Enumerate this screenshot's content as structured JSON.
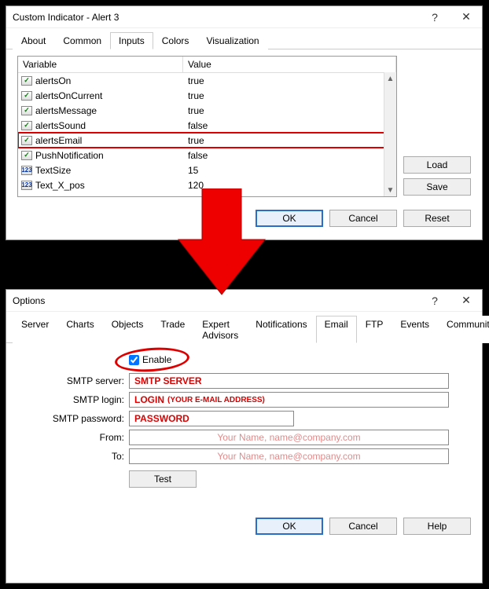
{
  "dialog1": {
    "title": "Custom Indicator - Alert 3",
    "help_icon": "?",
    "close_icon": "✕",
    "tabs": [
      "About",
      "Common",
      "Inputs",
      "Colors",
      "Visualization"
    ],
    "active_tab": 2,
    "columns": {
      "variable": "Variable",
      "value": "Value"
    },
    "rows": [
      {
        "icon": "bool",
        "name": "alertsOn",
        "value": "true"
      },
      {
        "icon": "bool",
        "name": "alertsOnCurrent",
        "value": "true"
      },
      {
        "icon": "bool",
        "name": "alertsMessage",
        "value": "true"
      },
      {
        "icon": "bool",
        "name": "alertsSound",
        "value": "false"
      },
      {
        "icon": "bool",
        "name": "alertsEmail",
        "value": "true",
        "highlight": true
      },
      {
        "icon": "bool",
        "name": "PushNotification",
        "value": "false"
      },
      {
        "icon": "num",
        "name": "TextSize",
        "value": "15"
      },
      {
        "icon": "num",
        "name": "Text_X_pos",
        "value": "120"
      }
    ],
    "buttons": {
      "load": "Load",
      "save": "Save",
      "ok": "OK",
      "cancel": "Cancel",
      "reset": "Reset"
    }
  },
  "dialog2": {
    "title": "Options",
    "help_icon": "?",
    "close_icon": "✕",
    "tabs": [
      "Server",
      "Charts",
      "Objects",
      "Trade",
      "Expert Advisors",
      "Notifications",
      "Email",
      "FTP",
      "Events",
      "Community"
    ],
    "active_tab": 6,
    "enable_label": "Enable",
    "enable_checked": true,
    "fields": {
      "smtp_server": {
        "label": "SMTP server:",
        "value": "SMTP SERVER"
      },
      "smtp_login": {
        "label": "SMTP login:",
        "value": "LOGIN",
        "note": "(YOUR E-MAIL ADDRESS)"
      },
      "smtp_password": {
        "label": "SMTP password:",
        "value": "PASSWORD"
      },
      "from": {
        "label": "From:",
        "placeholder": "Your Name, name@company.com"
      },
      "to": {
        "label": "To:",
        "placeholder": "Your Name, name@company.com"
      }
    },
    "buttons": {
      "test": "Test",
      "ok": "OK",
      "cancel": "Cancel",
      "help": "Help"
    }
  }
}
